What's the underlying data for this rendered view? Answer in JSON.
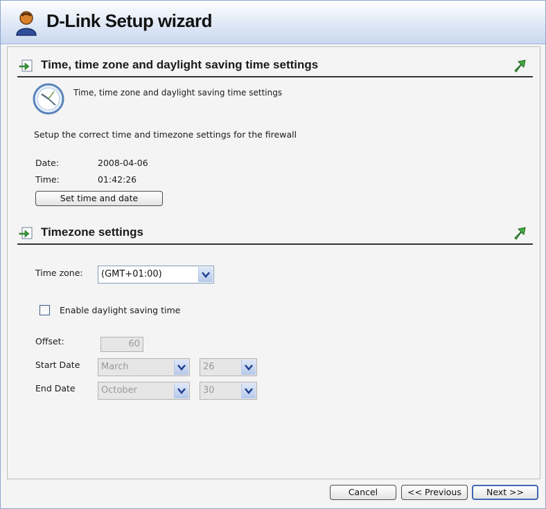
{
  "window": {
    "title": "D-Link Setup wizard"
  },
  "time_section": {
    "heading": "Time, time zone and daylight saving time settings",
    "icon_caption": "Time, time zone and daylight saving time settings",
    "description": "Setup the correct time and timezone settings for the firewall",
    "date_label": "Date:",
    "date_value": "2008-04-06",
    "time_label": "Time:",
    "time_value": "01:42:26",
    "set_button": "Set time and date"
  },
  "timezone_section": {
    "heading": "Timezone settings",
    "timezone_label": "Time zone:",
    "timezone_value": "(GMT+01:00)",
    "dst_checkbox_label": "Enable daylight saving time",
    "dst_checked": false,
    "offset_label": "Offset:",
    "offset_value": "60",
    "start_label": "Start Date",
    "start_month": "March",
    "start_day": "26",
    "end_label": "End Date",
    "end_month": "October",
    "end_day": "30"
  },
  "footer": {
    "cancel": "Cancel",
    "previous": "<< Previous",
    "next": "Next >>"
  },
  "icons": {
    "title": "user-avatar-icon",
    "section": "section-arrow-icon",
    "collapse": "up-arrow-icon",
    "clock": "clock-icon",
    "dropdown": "chevron-down-icon"
  },
  "colors": {
    "titlebar": "#c9d8ef",
    "dropdown_arrow": "#1f3f8f",
    "primary_button_border": "#3f67b0",
    "section_icon_green": "#3a9a3a"
  }
}
